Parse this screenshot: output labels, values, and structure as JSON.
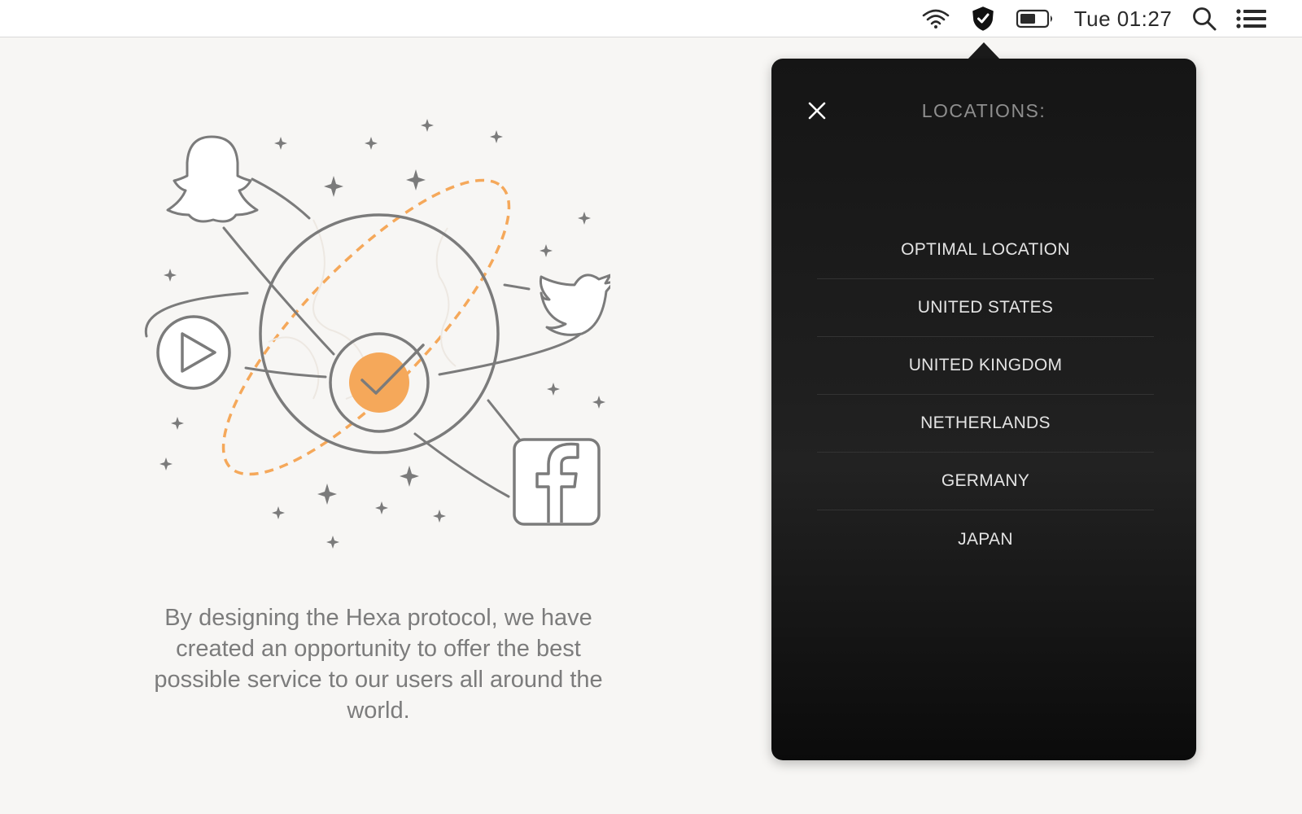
{
  "menubar": {
    "clock": "Tue 01:27",
    "icons": [
      "wifi-icon",
      "vpn-shield-icon",
      "battery-icon",
      "spotlight-search-icon",
      "notification-center-icon"
    ]
  },
  "main": {
    "tagline": "By designing the Hexa protocol, we have created an opportunity to offer the best possible service to our users all around the world.",
    "accent_color": "#f5a85a",
    "line_color": "#7b7b7b"
  },
  "popover": {
    "title": "LOCATIONS:",
    "locations": [
      {
        "label": "OPTIMAL LOCATION"
      },
      {
        "label": "UNITED STATES"
      },
      {
        "label": "UNITED KINGDOM"
      },
      {
        "label": "NETHERLANDS"
      },
      {
        "label": "GERMANY"
      },
      {
        "label": "JAPAN"
      }
    ],
    "background_color": "#1b1b1b",
    "text_color": "#e4e4e4"
  }
}
